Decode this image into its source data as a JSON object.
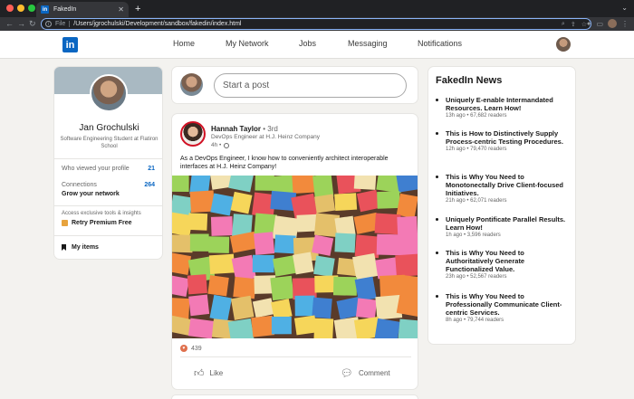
{
  "browser": {
    "tab_title": "FakedIn",
    "tab_favicon": "in",
    "scheme_label": "File",
    "url": "/Users/jgrochulski/Development/sandbox/fakedin/index.html"
  },
  "header": {
    "logo": "in",
    "nav": [
      "Home",
      "My Network",
      "Jobs",
      "Messaging",
      "Notifications"
    ]
  },
  "profile": {
    "name": "Jan Grochulski",
    "headline": "Software Engineering Student at Flatiron School",
    "viewed_label": "Who viewed your profile",
    "viewed_count": "21",
    "connections_label": "Connections",
    "connections_count": "264",
    "grow_label": "Grow your network",
    "premium_note": "Access exclusive tools & insights",
    "premium_label": "Retry Premium Free",
    "my_items_label": "My items"
  },
  "composer": {
    "placeholder": "Start a post"
  },
  "post": {
    "author": "Hannah Taylor",
    "degree": "• 3rd",
    "author_title": "DevOps Engineer at H.J. Heinz Company",
    "time": "4h •",
    "text": "As a DevOps Engineer, I know how to conveniently architect interoperable interfaces at H.J. Heinz Company!",
    "reactions": "439",
    "like_label": "Like",
    "comment_label": "Comment"
  },
  "news": {
    "title": "FakedIn News",
    "items": [
      {
        "headline": "Uniquely E-enable Intermandated Resources. Learn How!",
        "meta": "13h ago • 67,682 readers"
      },
      {
        "headline": "This is How to Distinctively Supply Process-centric Testing Procedures.",
        "meta": "12h ago • 79,470 readers"
      },
      {
        "headline": "This is Why You Need to Monotonectally Drive Client-focused Initiatives.",
        "meta": "21h ago • 62,071 readers"
      },
      {
        "headline": "Uniquely Pontificate Parallel Results. Learn How!",
        "meta": "1h ago • 3,596 readers"
      },
      {
        "headline": "This is Why You Need to Authoritatively Generate Functionalized Value.",
        "meta": "23h ago • 52,567 readers"
      },
      {
        "headline": "This is Why You Need to Professionally Communicate Client-centric Services.",
        "meta": "8h ago • 79,744 readers"
      }
    ]
  },
  "colors": {
    "brand": "#0a66c2",
    "page_bg": "#f3f2ef",
    "premium": "#e7a33e"
  }
}
